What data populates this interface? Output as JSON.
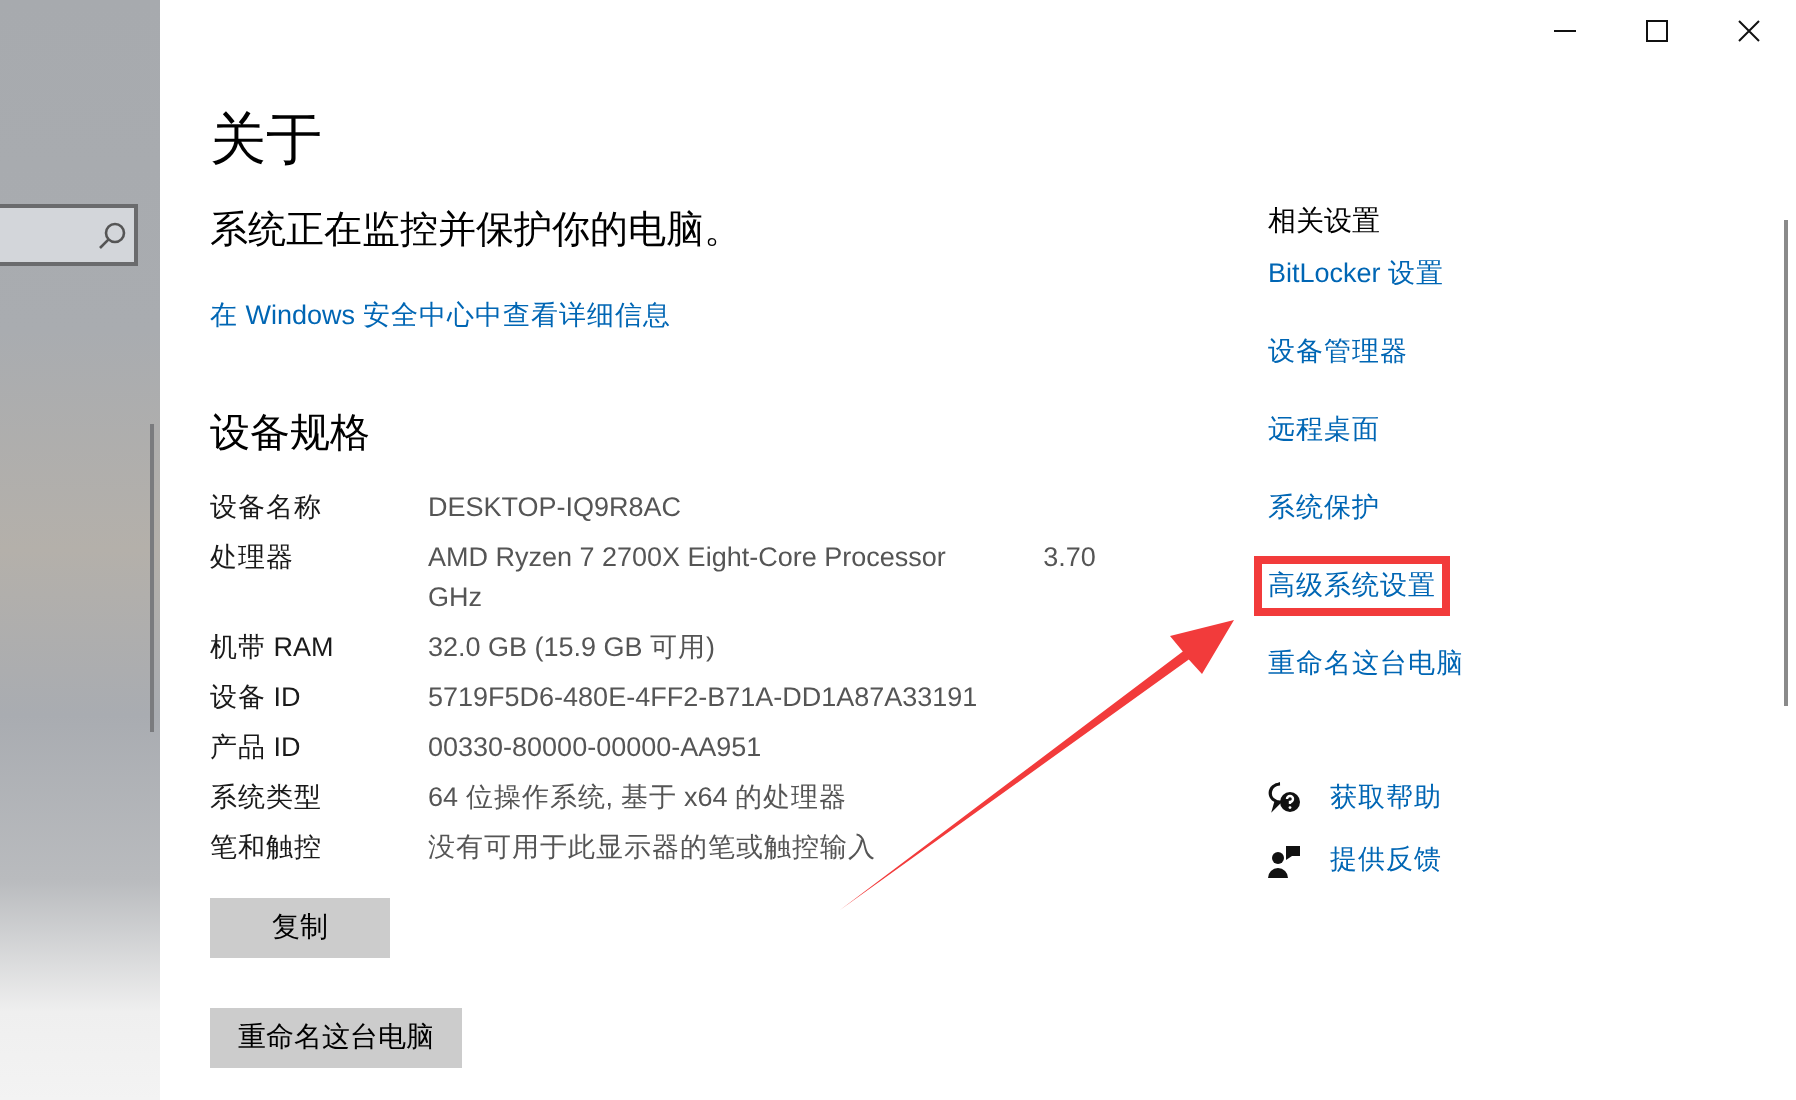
{
  "window_controls": [
    {
      "kind": "minimize"
    },
    {
      "kind": "maximize"
    },
    {
      "kind": "close"
    }
  ],
  "page": {
    "title": "关于",
    "status": "系统正在监控并保护你的电脑。",
    "details_link": "在 Windows 安全中心中查看详细信息"
  },
  "specs": {
    "heading": "设备规格",
    "rows": [
      {
        "label": "设备名称",
        "value": "DESKTOP-IQ9R8AC"
      },
      {
        "label": "处理器",
        "value": "AMD Ryzen 7 2700X Eight-Core Processor             3.70 GHz"
      },
      {
        "label": "机带 RAM",
        "value": "32.0 GB (15.9 GB 可用)"
      },
      {
        "label": "设备 ID",
        "value": "5719F5D6-480E-4FF2-B71A-DD1A87A33191"
      },
      {
        "label": "产品 ID",
        "value": "00330-80000-00000-AA951"
      },
      {
        "label": "系统类型",
        "value": "64 位操作系统, 基于 x64 的处理器"
      },
      {
        "label": "笔和触控",
        "value": "没有可用于此显示器的笔或触控输入"
      }
    ]
  },
  "buttons": [
    "复制",
    "重命名这台电脑"
  ],
  "related": {
    "heading": "相关设置",
    "links": [
      {
        "label": "BitLocker 设置",
        "highlighted": false
      },
      {
        "label": "设备管理器",
        "highlighted": false
      },
      {
        "label": "远程桌面",
        "highlighted": false
      },
      {
        "label": "系统保护",
        "highlighted": false
      },
      {
        "label": "高级系统设置",
        "highlighted": true
      },
      {
        "label": "重命名这台电脑",
        "highlighted": false
      }
    ]
  },
  "support": [
    {
      "kind": "help",
      "label": "获取帮助"
    },
    {
      "kind": "feedback",
      "label": "提供反馈"
    }
  ]
}
